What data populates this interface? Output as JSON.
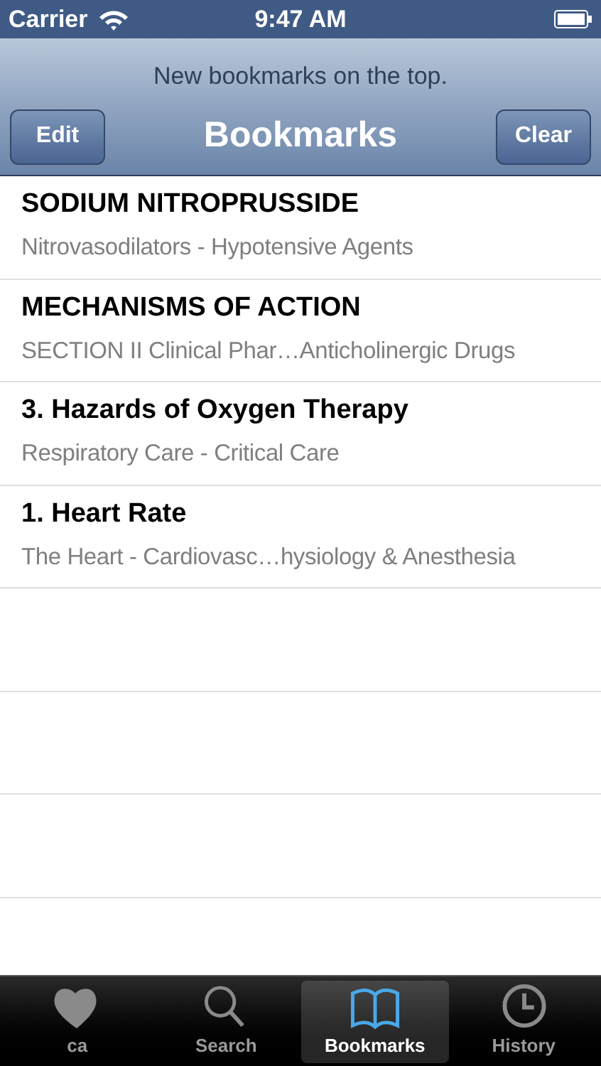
{
  "status_bar": {
    "carrier": "Carrier",
    "time": "9:47 AM"
  },
  "nav": {
    "subtitle": "New bookmarks on the top.",
    "title": "Bookmarks",
    "left_button": "Edit",
    "right_button": "Clear"
  },
  "bookmarks": [
    {
      "title": "SODIUM NITROPRUSSIDE",
      "subtitle": "Nitrovasodilators - Hypotensive Agents"
    },
    {
      "title": "MECHANISMS OF ACTION",
      "subtitle": "SECTION II Clinical Phar…Anticholinergic Drugs"
    },
    {
      "title": "3. Hazards of Oxygen Therapy",
      "subtitle": "Respiratory Care - Critical Care"
    },
    {
      "title": "1. Heart Rate",
      "subtitle": "The Heart - Cardiovasc…hysiology & Anesthesia"
    }
  ],
  "tabs": [
    {
      "kind": "heart",
      "label": "ca",
      "selected": false
    },
    {
      "kind": "search",
      "label": "Search",
      "selected": false
    },
    {
      "kind": "book",
      "label": "Bookmarks",
      "selected": true
    },
    {
      "kind": "clock",
      "label": "History",
      "selected": false
    }
  ]
}
